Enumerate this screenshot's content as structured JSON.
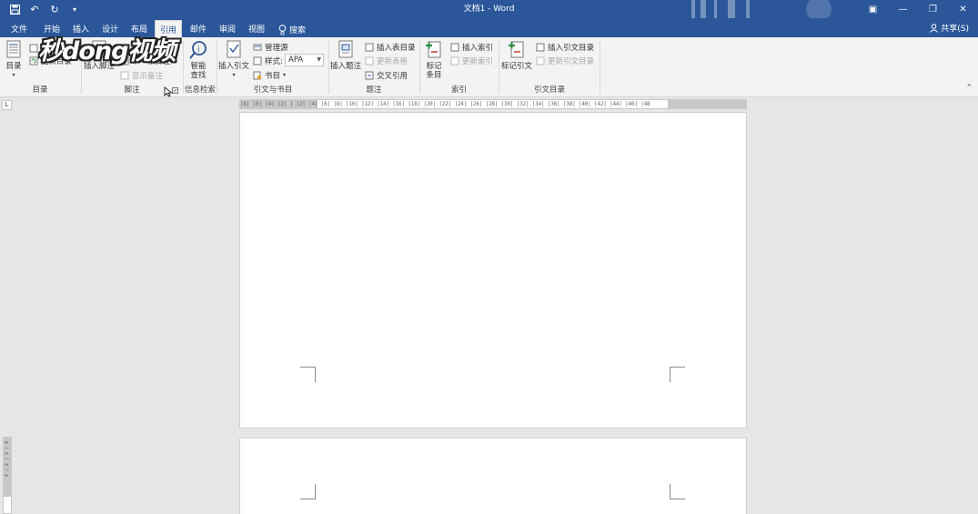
{
  "titlebar": {
    "title": "文档1 - Word",
    "qat": {
      "save": "💾",
      "undo": "↶",
      "redo": "↻",
      "customize": "▾"
    },
    "window": {
      "ribbon_display": "▣",
      "minimize": "—",
      "restore": "❐",
      "close": "✕"
    }
  },
  "tabs": [
    {
      "label": "文件"
    },
    {
      "label": "开始"
    },
    {
      "label": "插入"
    },
    {
      "label": "设计"
    },
    {
      "label": "布局"
    },
    {
      "label": "引用",
      "active": true
    },
    {
      "label": "邮件"
    },
    {
      "label": "审阅"
    },
    {
      "label": "视图"
    },
    {
      "label": "搜索"
    }
  ],
  "share": "共享(S)",
  "ribbon": {
    "toc": {
      "big": "目录",
      "small1": "添加文字",
      "small2": "更新目录",
      "group": "目录"
    },
    "footnotes": {
      "big": "插入脚注",
      "small1": "插入尾注",
      "small2": "下一条脚注",
      "small3": "显示备注",
      "group": "脚注"
    },
    "research": {
      "big1": "智能",
      "big2": "查找",
      "group": "信息检索"
    },
    "citations": {
      "big": "插入引文",
      "manage": "管理源",
      "style_label": "样式:",
      "style_value": "APA",
      "bibliography": "书目",
      "group": "引文与书目"
    },
    "captions": {
      "big": "插入题注",
      "insert_tof": "插入表目录",
      "update_table": "更新表格",
      "cross_ref": "交叉引用",
      "group": "题注"
    },
    "index": {
      "big1": "标记",
      "big2": "条目",
      "insert_index": "插入索引",
      "update_index": "更新索引",
      "group": "索引"
    },
    "toa": {
      "big": "标记引文",
      "insert_toa": "插入引文目录",
      "update_toa": "更新引文目录",
      "group": "引文目录"
    }
  },
  "watermark": "秒dong视频",
  "ruler": {
    "ticks": "|8| |6| |4| |2| | |2| |4| |6| |8| |10| |12| |14| |16| |18| |20| |22| |24| |26| |28| |30| |32| |34| |36| |38| |40| |42| |44| |46| |48",
    "vticks": "4 | 2 | 2 | 4"
  },
  "colors": {
    "accent": "#2b579a",
    "ribbon_bg": "#f3f3f3",
    "canvas_bg": "#e6e6e6"
  }
}
